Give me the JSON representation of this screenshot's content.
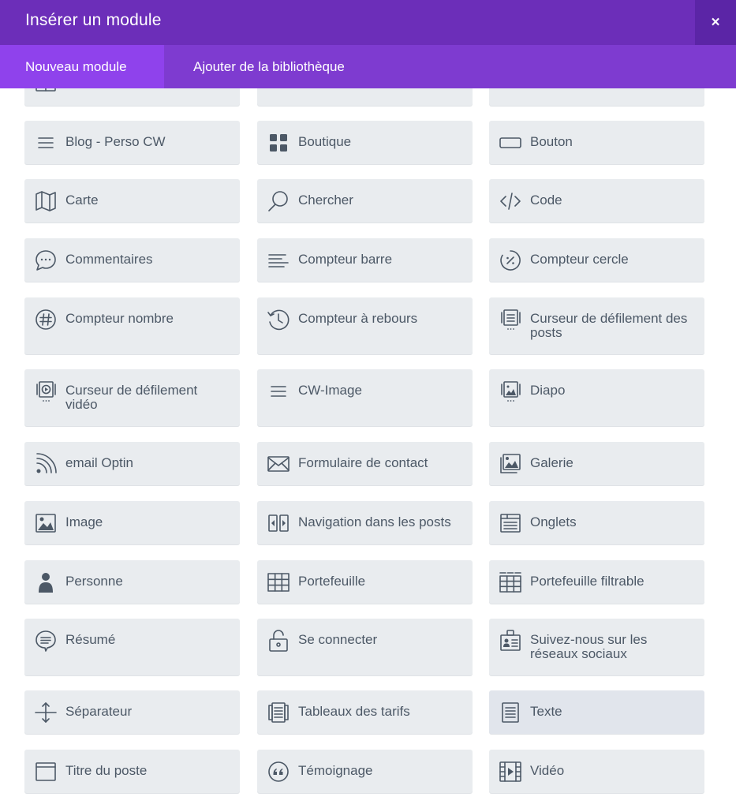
{
  "dialog": {
    "title": "Insérer un module",
    "close_label": "×",
    "tabs": [
      {
        "label": "Nouveau module",
        "active": true
      },
      {
        "label": "Ajouter de la bibliothèque",
        "active": false
      }
    ]
  },
  "modules": [
    {
      "label": "Blog - Perso CW",
      "icon": "hamburger-icon"
    },
    {
      "label": "Boutique",
      "icon": "grid-icon"
    },
    {
      "label": "Bouton",
      "icon": "button-icon"
    },
    {
      "label": "Carte",
      "icon": "map-icon"
    },
    {
      "label": "Chercher",
      "icon": "search-icon"
    },
    {
      "label": "Code",
      "icon": "code-icon"
    },
    {
      "label": "Commentaires",
      "icon": "comment-icon"
    },
    {
      "label": "Compteur barre",
      "icon": "bar-counter-icon"
    },
    {
      "label": "Compteur cercle",
      "icon": "circle-counter-icon"
    },
    {
      "label": "Compteur nombre",
      "icon": "hash-icon"
    },
    {
      "label": "Compteur à rebours",
      "icon": "history-icon"
    },
    {
      "label": "Curseur de défilement des posts",
      "icon": "post-slider-icon"
    },
    {
      "label": "Curseur de défilement vidéo",
      "icon": "video-slider-icon"
    },
    {
      "label": "CW-Image",
      "icon": "hamburger-icon"
    },
    {
      "label": "Diapo",
      "icon": "slider-icon"
    },
    {
      "label": "email Optin",
      "icon": "rss-icon"
    },
    {
      "label": "Formulaire de contact",
      "icon": "envelope-icon"
    },
    {
      "label": "Galerie",
      "icon": "gallery-icon"
    },
    {
      "label": "Image",
      "icon": "image-icon"
    },
    {
      "label": "Navigation dans les posts",
      "icon": "post-navigation-icon"
    },
    {
      "label": "Onglets",
      "icon": "tabs-icon"
    },
    {
      "label": "Personne",
      "icon": "person-icon"
    },
    {
      "label": "Portefeuille",
      "icon": "portfolio-grid-icon"
    },
    {
      "label": "Portefeuille filtrable",
      "icon": "filterable-portfolio-icon"
    },
    {
      "label": "Résumé",
      "icon": "summary-icon"
    },
    {
      "label": "Se connecter",
      "icon": "unlock-icon"
    },
    {
      "label": "Suivez-nous sur les réseaux sociaux",
      "icon": "social-badge-icon"
    },
    {
      "label": "Séparateur",
      "icon": "divider-icon"
    },
    {
      "label": "Tableaux des tarifs",
      "icon": "pricing-table-icon"
    },
    {
      "label": "Texte",
      "icon": "text-icon",
      "selected": true
    },
    {
      "label": "Titre du poste",
      "icon": "post-title-icon"
    },
    {
      "label": "Témoignage",
      "icon": "quote-icon"
    },
    {
      "label": "Vidéo",
      "icon": "video-icon"
    }
  ],
  "colors": {
    "header_bg": "#6c2eb9",
    "tabs_bg": "#7e3bd0",
    "active_tab_bg": "#8f42ec",
    "module_bg": "#e9ecef",
    "module_text": "#4c5866"
  }
}
